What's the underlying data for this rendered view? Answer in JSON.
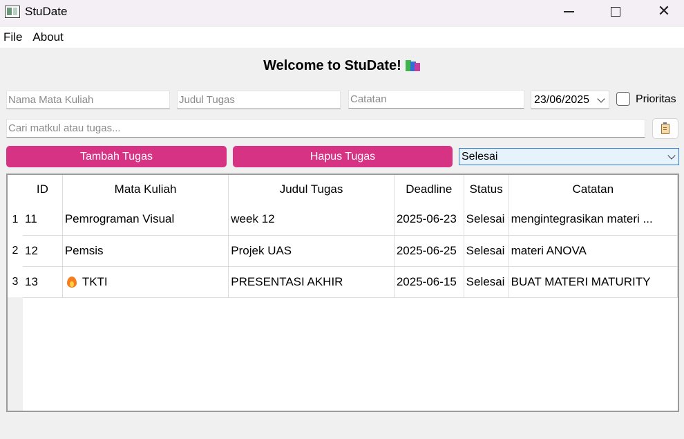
{
  "window": {
    "title": "StuDate"
  },
  "menu": {
    "file": "File",
    "about": "About"
  },
  "welcome": "Welcome to StuDate!",
  "form": {
    "matkul_placeholder": "Nama Mata Kuliah",
    "judul_placeholder": "Judul Tugas",
    "catatan_placeholder": "Catatan",
    "date_value": "23/06/2025",
    "prioritas_label": "Prioritas",
    "search_placeholder": "Cari matkul atau tugas..."
  },
  "buttons": {
    "add": "Tambah Tugas",
    "delete": "Hapus Tugas"
  },
  "status_filter": {
    "selected": "Selesai"
  },
  "table": {
    "headers": [
      "ID",
      "Mata Kuliah",
      "Judul Tugas",
      "Deadline",
      "Status",
      "Catatan"
    ],
    "rows": [
      {
        "num": "1",
        "id": "11",
        "matkul": "Pemrograman Visual",
        "priority": false,
        "judul": "week 12",
        "deadline": "2025-06-23",
        "status": "Selesai",
        "catatan": "mengintegrasikan materi ..."
      },
      {
        "num": "2",
        "id": "12",
        "matkul": "Pemsis",
        "priority": false,
        "judul": "Projek UAS",
        "deadline": "2025-06-25",
        "status": "Selesai",
        "catatan": "materi ANOVA"
      },
      {
        "num": "3",
        "id": "13",
        "matkul": "TKTI",
        "priority": true,
        "judul": "PRESENTASI AKHIR",
        "deadline": "2025-06-15",
        "status": "Selesai",
        "catatan": "BUAT MATERI MATURITY"
      }
    ]
  },
  "colors": {
    "accent": "#d63384",
    "select_border": "#2b7bd1",
    "select_bg": "#e7f3fc"
  }
}
